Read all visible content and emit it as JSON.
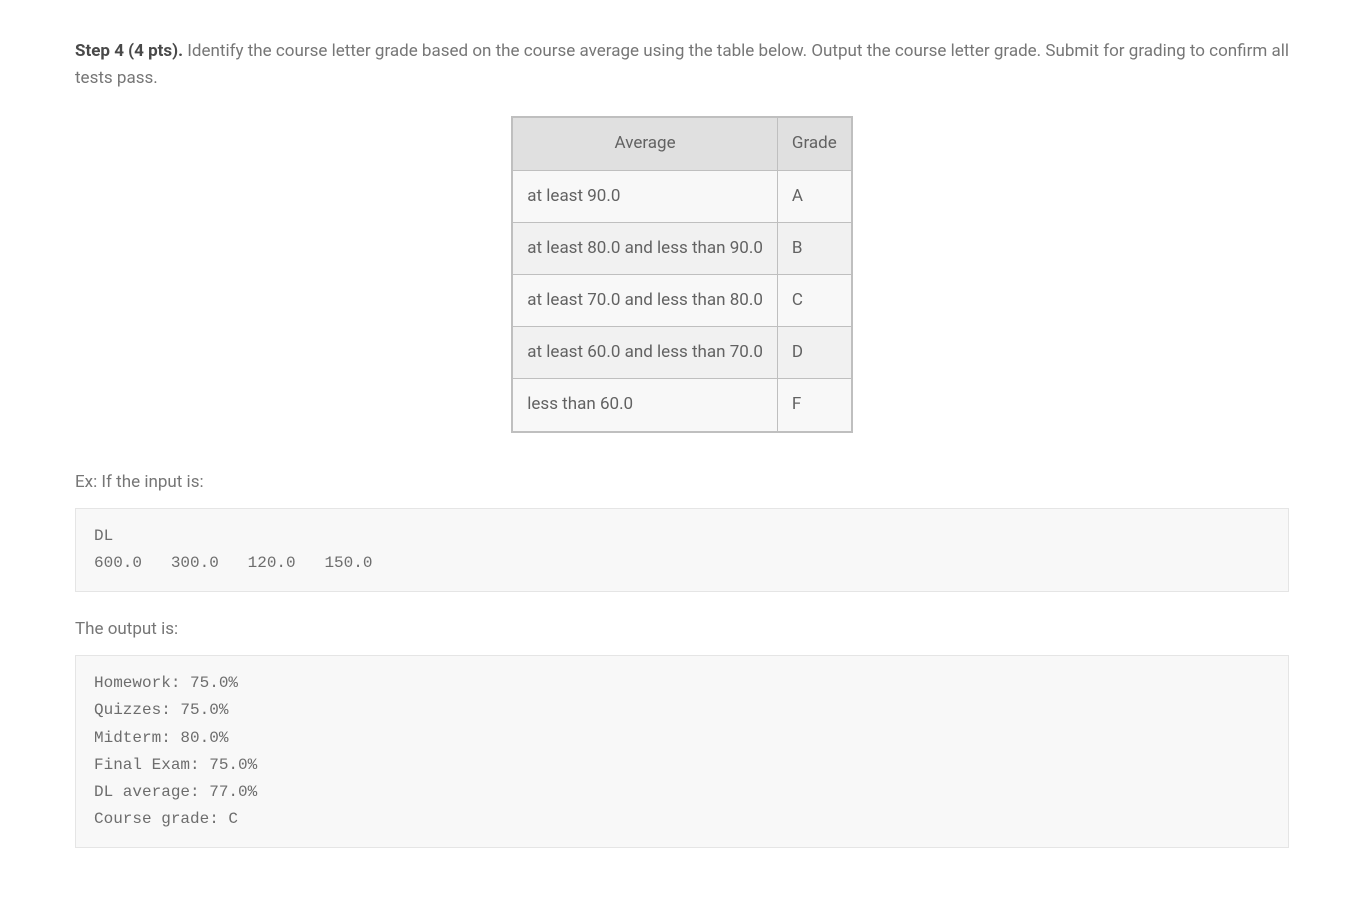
{
  "step": {
    "label": "Step 4 (4 pts).",
    "text": " Identify the course letter grade based on the course average using the table below. Output the course letter grade. Submit for grading to confirm all tests pass."
  },
  "table": {
    "headers": {
      "average": "Average",
      "grade": "Grade"
    },
    "rows": [
      {
        "average": "at least 90.0",
        "grade": "A"
      },
      {
        "average": "at least 80.0 and less than 90.0",
        "grade": "B"
      },
      {
        "average": "at least 70.0 and less than 80.0",
        "grade": "C"
      },
      {
        "average": "at least 60.0 and less than 70.0",
        "grade": "D"
      },
      {
        "average": "less than 60.0",
        "grade": "F"
      }
    ]
  },
  "example": {
    "intro": "Ex: If the input is:",
    "input_code": "DL\n600.0   300.0   120.0   150.0",
    "output_intro": "The output is:",
    "output_code": "Homework: 75.0%\nQuizzes: 75.0%\nMidterm: 80.0%\nFinal Exam: 75.0%\nDL average: 77.0%\nCourse grade: C"
  }
}
